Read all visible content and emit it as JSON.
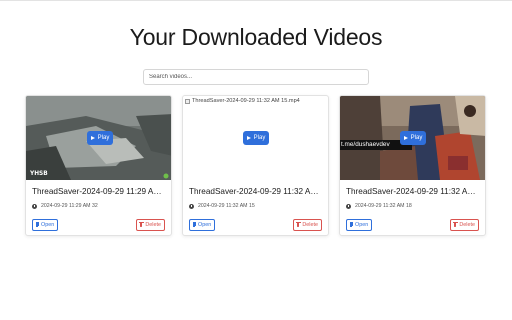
{
  "page": {
    "title": "Your Downloaded Videos",
    "search_placeholder": "Search videos..."
  },
  "videos": [
    {
      "title": "ThreadSaver-2024-09-29 11:29 AM 32...",
      "timestamp": "2024-09-29 11:29 AM 32",
      "play_label": "Play",
      "open_label": "Open",
      "delete_label": "Delete",
      "watermark": "YHSB"
    },
    {
      "title": "ThreadSaver-2024-09-29 11:32 AM 15....",
      "timestamp": "2024-09-29 11:32 AM 15",
      "play_label": "Play",
      "open_label": "Open",
      "delete_label": "Delete",
      "broken_alt": "ThreadSaver-2024-09-29 11:32 AM 15.mp4"
    },
    {
      "title": "ThreadSaver-2024-09-29 11:32 AM 18....",
      "timestamp": "2024-09-29 11:32 AM 18",
      "play_label": "Play",
      "open_label": "Open",
      "delete_label": "Delete",
      "watermark": "t.me/dushaevdev"
    }
  ],
  "colors": {
    "primary": "#2f6fdb",
    "danger": "#d9534f",
    "text": "#1c1c1c"
  }
}
